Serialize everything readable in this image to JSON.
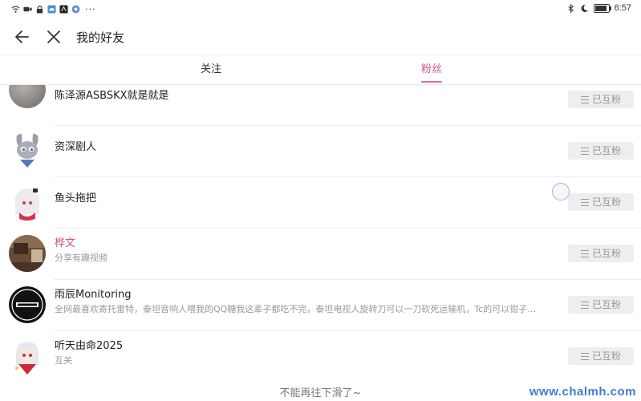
{
  "statusbar": {
    "left_icons": [
      "wifi-icon",
      "video-icon",
      "lock-icon",
      "cloud-icon",
      "app-icon",
      "browser-icon"
    ],
    "ellipsis": "···",
    "right_icons": [
      "bluetooth-icon",
      "moon-icon",
      "battery-icon"
    ],
    "battery_level": 0.85,
    "time": "6:57"
  },
  "header": {
    "title": "我的好友",
    "back_icon": "arrow-left-icon",
    "close_icon": "close-icon"
  },
  "tabs": {
    "follow": "关注",
    "fans": "粉丝",
    "active": "fans",
    "active_color": "#d44f8e"
  },
  "list": {
    "button_label": "已互粉",
    "button_icon": "menu-icon",
    "items": [
      {
        "name": "陈泽源ASBSKX就是就是",
        "desc": "",
        "avatar": "gray-circle-avatar"
      },
      {
        "name": "资深剧人",
        "desc": "",
        "avatar": "cartoon-rabbit-avatar"
      },
      {
        "name": "鱼头拖把",
        "desc": "",
        "avatar": "anime-girl-avatar"
      },
      {
        "name": "桦文",
        "desc": "分享有趣视频",
        "avatar": "room-photo-avatar",
        "name_color": "#d44f8e"
      },
      {
        "name": "雨辰Monitoring",
        "desc": "全网最喜欢寄托雷特，泰坦音响人喂我的QQ糖我这辈子都吃不完，泰坦电视人旋转刀可以一刀砍死运输机，Tc的可以钳子…",
        "avatar": "logo-avatar"
      },
      {
        "name": "听天由命2025",
        "desc": "互关",
        "avatar": "anime-girl-red-avatar"
      }
    ]
  },
  "footer": {
    "end_text": "不能再往下滑了~",
    "watermark": "www.chalmh.com"
  }
}
